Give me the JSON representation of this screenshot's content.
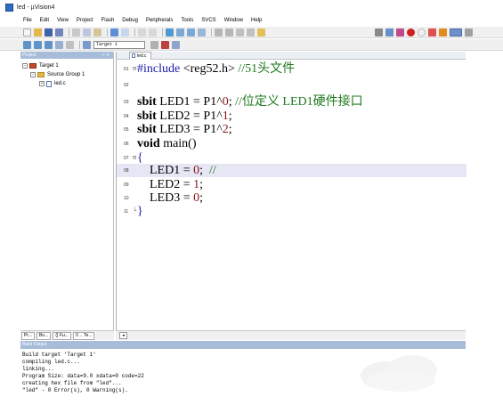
{
  "window": {
    "title": "led - µVision4"
  },
  "menu": [
    "File",
    "Edit",
    "View",
    "Project",
    "Flash",
    "Debug",
    "Peripherals",
    "Tools",
    "SVCS",
    "Window",
    "Help"
  ],
  "toolbar": {
    "target": "Target 1"
  },
  "project_panel": {
    "header": "Project",
    "tree": {
      "target": "Target 1",
      "group": "Source Group 1",
      "file": "led.c"
    },
    "tabs": [
      "Pr...",
      "Bo...",
      "{} Fu...",
      "0→ Te..."
    ]
  },
  "editor": {
    "tab": "led.c",
    "lines": [
      {
        "num": "01",
        "fold": "⊟",
        "code": "#include <reg52.h> //51头文件"
      },
      {
        "num": "02",
        "fold": "",
        "code": ""
      },
      {
        "num": "03",
        "fold": "",
        "code": "sbit LED1 = P1^0; //位定义 LED1硬件接口"
      },
      {
        "num": "04",
        "fold": "",
        "code": "sbit LED2 = P1^1;"
      },
      {
        "num": "05",
        "fold": "",
        "code": "sbit LED3 = P1^2;"
      },
      {
        "num": "06",
        "fold": "",
        "code": "void main()"
      },
      {
        "num": "07",
        "fold": "⊟",
        "code": "{"
      },
      {
        "num": "08",
        "fold": "",
        "code": "    LED1 = 0;  //"
      },
      {
        "num": "09",
        "fold": "",
        "code": "    LED2 = 1;"
      },
      {
        "num": "10",
        "fold": "",
        "code": "    LED3 = 0;"
      },
      {
        "num": "11",
        "fold": "└",
        "code": "}"
      }
    ]
  },
  "build_output": {
    "header": "Build Output",
    "lines": [
      "Build target 'Target 1'",
      "compiling led.c...",
      "linking...",
      "Program Size: data=9.0 xdata=0 code=22",
      "creating hex file from \"led\"...",
      "\"led\" - 0 Error(s), 0 Warning(s)."
    ]
  }
}
